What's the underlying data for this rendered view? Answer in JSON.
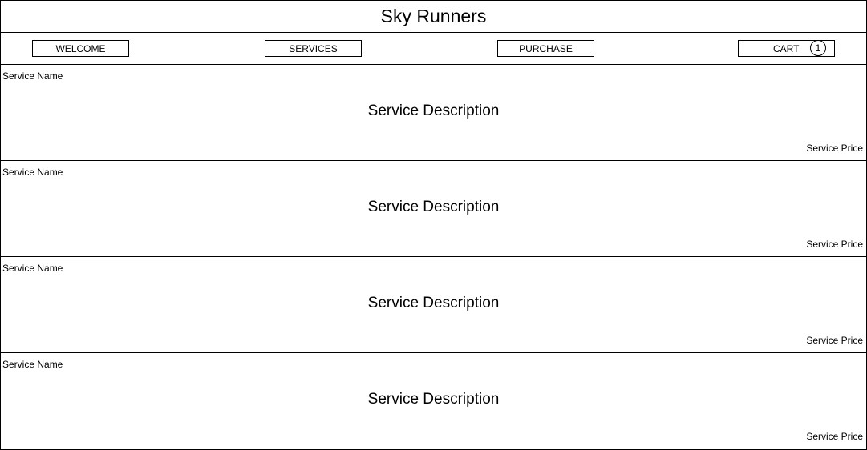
{
  "header": {
    "title": "Sky Runners"
  },
  "nav": {
    "welcome": "WELCOME",
    "services": "SERVICES",
    "purchase": "PURCHASE",
    "cart": "CART",
    "cart_count": "1"
  },
  "services": [
    {
      "name": "Service Name",
      "description": "Service Description",
      "price": "Service Price"
    },
    {
      "name": "Service Name",
      "description": "Service Description",
      "price": "Service Price"
    },
    {
      "name": "Service Name",
      "description": "Service Description",
      "price": "Service Price"
    },
    {
      "name": "Service Name",
      "description": "Service Description",
      "price": "Service Price"
    }
  ]
}
